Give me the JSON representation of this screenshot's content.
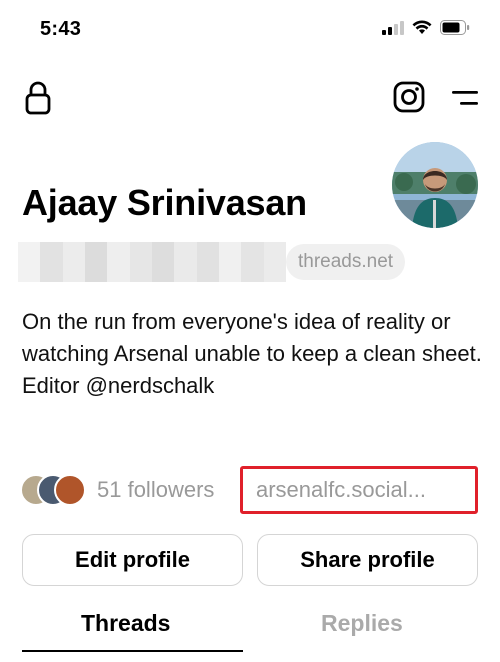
{
  "status_bar": {
    "time": "5:43",
    "icons": [
      "cellular-signal-icon",
      "wifi-icon",
      "battery-icon"
    ]
  },
  "header": {
    "left_icon": "lock-icon",
    "right_icons": [
      "instagram-icon",
      "menu-icon"
    ]
  },
  "profile": {
    "name": "Ajaay Srinivasan",
    "domain": "threads.net",
    "bio": "On the run from everyone's idea of reality or watching Arsenal unable to keep a clean sheet. Editor @nerdschalk",
    "followers": "51 followers",
    "link": "arsenalfc.social..."
  },
  "actions": {
    "edit_profile": "Edit profile",
    "share_profile": "Share profile"
  },
  "tabs": [
    {
      "label": "Threads",
      "active": true
    },
    {
      "label": "Replies",
      "active": false
    }
  ],
  "colors": {
    "highlight_box": "#e0202a",
    "muted_text": "#999999",
    "button_border": "#d5d5d5"
  }
}
